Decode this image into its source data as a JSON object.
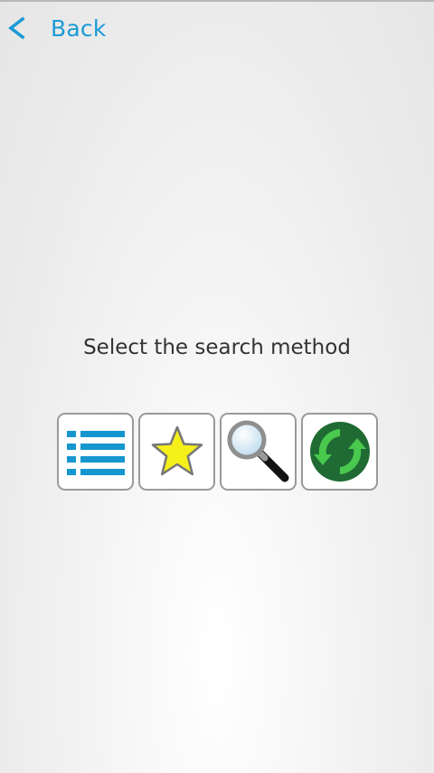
{
  "header": {
    "back_label": "Back",
    "back_icon": "chevron-left-icon"
  },
  "main": {
    "prompt": "Select the search method",
    "methods": [
      {
        "name": "list",
        "icon": "list-icon"
      },
      {
        "name": "favorites",
        "icon": "star-icon"
      },
      {
        "name": "search",
        "icon": "magnifier-icon"
      },
      {
        "name": "recycle",
        "icon": "recycle-icon"
      }
    ]
  },
  "colors": {
    "accent": "#1a9ad6",
    "star_fill": "#f5ef1a",
    "recycle_dark": "#1f6b33",
    "recycle_light": "#49c94d"
  }
}
